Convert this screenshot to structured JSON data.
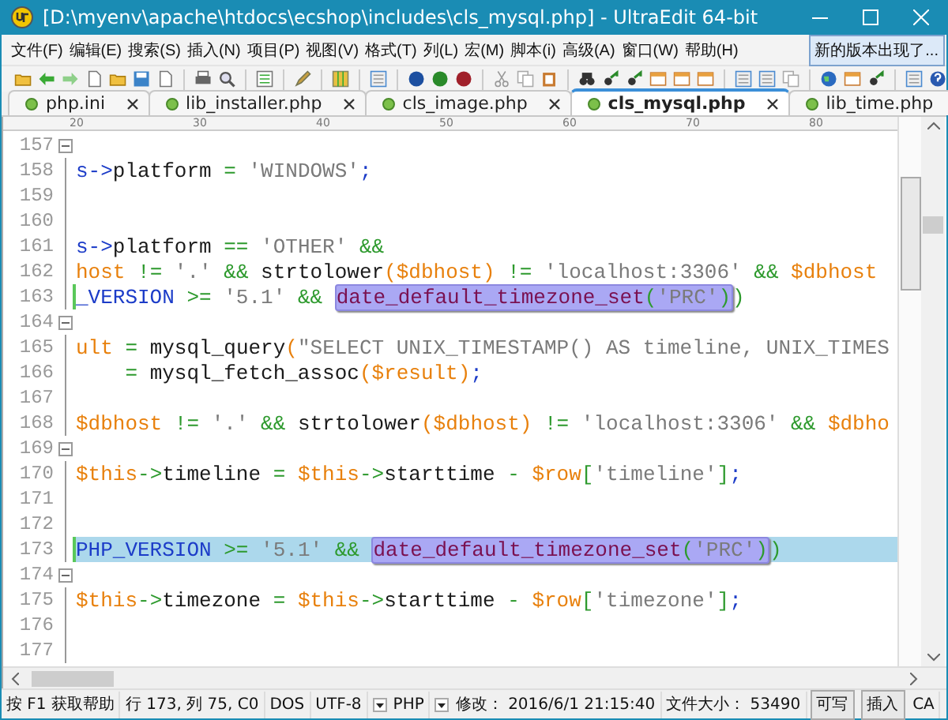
{
  "window": {
    "title": "[D:\\myenv\\apache\\htdocs\\ecshop\\includes\\cls_mysql.php] - UltraEdit 64-bit"
  },
  "menu": {
    "items": [
      "文件(F)",
      "编辑(E)",
      "搜索(S)",
      "插入(N)",
      "项目(P)",
      "视图(V)",
      "格式(T)",
      "列(L)",
      "宏(M)",
      "脚本(i)",
      "高级(A)",
      "窗口(W)",
      "帮助(H)"
    ],
    "notice_button": "新的版本出现了..."
  },
  "tabs": [
    {
      "label": "php.ini",
      "selected": false
    },
    {
      "label": "lib_installer.php",
      "selected": false
    },
    {
      "label": "cls_image.php",
      "selected": false
    },
    {
      "label": "cls_mysql.php",
      "selected": true
    },
    {
      "label": "lib_time.php",
      "selected": false
    }
  ],
  "ruler": [
    "20",
    "30",
    "40",
    "50",
    "60",
    "70",
    "80"
  ],
  "lines": [
    {
      "number": "157",
      "fold": true,
      "modified": false,
      "current": false
    },
    {
      "number": "158",
      "fold": false,
      "modified": false,
      "current": false,
      "tokens": [
        {
          "text": "s->",
          "kind": "keyword"
        },
        {
          "text": "platform ",
          "kind": "plain"
        },
        {
          "text": "=",
          "kind": "operator"
        },
        {
          "text": " 'WINDOWS'",
          "kind": "string"
        },
        {
          "text": ";",
          "kind": "keyword"
        }
      ]
    },
    {
      "number": "159",
      "fold": false,
      "modified": false,
      "current": false
    },
    {
      "number": "160",
      "fold": false,
      "modified": false,
      "current": false
    },
    {
      "number": "161",
      "fold": false,
      "modified": false,
      "current": false,
      "tokens": [
        {
          "text": "s->",
          "kind": "keyword"
        },
        {
          "text": "platform ",
          "kind": "plain"
        },
        {
          "text": "==",
          "kind": "operator"
        },
        {
          "text": " 'OTHER' ",
          "kind": "string"
        },
        {
          "text": "&&",
          "kind": "operator"
        }
      ]
    },
    {
      "number": "162",
      "fold": false,
      "modified": false,
      "current": false,
      "tokens": [
        {
          "text": "host ",
          "kind": "variable"
        },
        {
          "text": "!=",
          "kind": "operator"
        },
        {
          "text": " '.' ",
          "kind": "string"
        },
        {
          "text": "&&",
          "kind": "operator"
        },
        {
          "text": " strtolower",
          "kind": "plain"
        },
        {
          "text": "($dbhost) ",
          "kind": "variable"
        },
        {
          "text": "!=",
          "kind": "operator"
        },
        {
          "text": " 'localhost:3306' ",
          "kind": "string"
        },
        {
          "text": "&&",
          "kind": "operator"
        },
        {
          "text": " $dbhost",
          "kind": "variable"
        }
      ]
    },
    {
      "number": "163",
      "fold": false,
      "modified": true,
      "current": false,
      "tokens": [
        {
          "text": "_VERSION ",
          "kind": "keyword"
        },
        {
          "text": ">=",
          "kind": "operator"
        },
        {
          "text": " '5.1' ",
          "kind": "string"
        },
        {
          "text": "&& ",
          "kind": "operator"
        },
        {
          "kind": "match",
          "tokens": [
            {
              "text": "date_default_timezone_set",
              "kind": "function"
            },
            {
              "text": "(",
              "kind": "operator"
            },
            {
              "text": "'PRC'",
              "kind": "string"
            },
            {
              "text": ")",
              "kind": "operator"
            }
          ]
        },
        {
          "text": ")",
          "kind": "operator"
        }
      ]
    },
    {
      "number": "164",
      "fold": true,
      "modified": false,
      "current": false
    },
    {
      "number": "165",
      "fold": false,
      "modified": false,
      "current": false,
      "tokens": [
        {
          "text": "ult ",
          "kind": "variable"
        },
        {
          "text": "=",
          "kind": "operator"
        },
        {
          "text": " mysql_query",
          "kind": "plain"
        },
        {
          "text": "(",
          "kind": "variable"
        },
        {
          "text": "\"SELECT UNIX_TIMESTAMP() AS timeline, UNIX_TIMES",
          "kind": "string"
        }
      ]
    },
    {
      "number": "166",
      "fold": false,
      "modified": false,
      "current": false,
      "tokens": [
        {
          "text": "    =",
          "kind": "operator"
        },
        {
          "text": " mysql_fetch_assoc",
          "kind": "plain"
        },
        {
          "text": "($result)",
          "kind": "variable"
        },
        {
          "text": ";",
          "kind": "keyword"
        }
      ]
    },
    {
      "number": "167",
      "fold": false,
      "modified": false,
      "current": false
    },
    {
      "number": "168",
      "fold": false,
      "modified": false,
      "current": false,
      "tokens": [
        {
          "text": "$dbhost ",
          "kind": "variable"
        },
        {
          "text": "!=",
          "kind": "operator"
        },
        {
          "text": " '.' ",
          "kind": "string"
        },
        {
          "text": "&&",
          "kind": "operator"
        },
        {
          "text": " strtolower",
          "kind": "plain"
        },
        {
          "text": "($dbhost) ",
          "kind": "variable"
        },
        {
          "text": "!=",
          "kind": "operator"
        },
        {
          "text": " 'localhost:3306' ",
          "kind": "string"
        },
        {
          "text": "&&",
          "kind": "operator"
        },
        {
          "text": " $dbho",
          "kind": "variable"
        }
      ]
    },
    {
      "number": "169",
      "fold": true,
      "modified": false,
      "current": false
    },
    {
      "number": "170",
      "fold": false,
      "modified": false,
      "current": false,
      "tokens": [
        {
          "text": "$this",
          "kind": "variable"
        },
        {
          "text": "->",
          "kind": "operator"
        },
        {
          "text": "timeline ",
          "kind": "plain"
        },
        {
          "text": "=",
          "kind": "operator"
        },
        {
          "text": " $this",
          "kind": "variable"
        },
        {
          "text": "->",
          "kind": "operator"
        },
        {
          "text": "starttime ",
          "kind": "plain"
        },
        {
          "text": "-",
          "kind": "operator"
        },
        {
          "text": " $row",
          "kind": "variable"
        },
        {
          "text": "[",
          "kind": "operator"
        },
        {
          "text": "'timeline'",
          "kind": "string"
        },
        {
          "text": "]",
          "kind": "operator"
        },
        {
          "text": ";",
          "kind": "keyword"
        }
      ]
    },
    {
      "number": "171",
      "fold": false,
      "modified": false,
      "current": false
    },
    {
      "number": "172",
      "fold": false,
      "modified": false,
      "current": false
    },
    {
      "number": "173",
      "fold": false,
      "modified": true,
      "current": true,
      "tokens": [
        {
          "text": "PHP_VERSION ",
          "kind": "keyword"
        },
        {
          "text": ">=",
          "kind": "operator"
        },
        {
          "text": " '5.1' ",
          "kind": "string"
        },
        {
          "text": "&& ",
          "kind": "operator"
        },
        {
          "kind": "match",
          "tokens": [
            {
              "text": "date_default_timezone_set",
              "kind": "function"
            },
            {
              "text": "(",
              "kind": "operator"
            },
            {
              "text": "'PRC'",
              "kind": "string"
            },
            {
              "text": ")",
              "kind": "operator"
            }
          ]
        },
        {
          "text": ")",
          "kind": "operator"
        }
      ]
    },
    {
      "number": "174",
      "fold": true,
      "modified": false,
      "current": false
    },
    {
      "number": "175",
      "fold": false,
      "modified": false,
      "current": false,
      "tokens": [
        {
          "text": "$this",
          "kind": "variable"
        },
        {
          "text": "->",
          "kind": "operator"
        },
        {
          "text": "timezone ",
          "kind": "plain"
        },
        {
          "text": "=",
          "kind": "operator"
        },
        {
          "text": " $this",
          "kind": "variable"
        },
        {
          "text": "->",
          "kind": "operator"
        },
        {
          "text": "starttime ",
          "kind": "plain"
        },
        {
          "text": "-",
          "kind": "operator"
        },
        {
          "text": " $row",
          "kind": "variable"
        },
        {
          "text": "[",
          "kind": "operator"
        },
        {
          "text": "'timezone'",
          "kind": "string"
        },
        {
          "text": "]",
          "kind": "operator"
        },
        {
          "text": ";",
          "kind": "keyword"
        }
      ]
    },
    {
      "number": "176",
      "fold": false,
      "modified": false,
      "current": false
    },
    {
      "number": "177",
      "fold": false,
      "modified": false,
      "current": false
    }
  ],
  "status_bar": [
    {
      "text": "按 F1 获取帮助",
      "kind": "panel"
    },
    {
      "text": "行 173, 列 75, C0",
      "kind": "panel"
    },
    {
      "text": "DOS",
      "kind": "panel"
    },
    {
      "text": "UTF-8",
      "kind": "panel"
    },
    {
      "text": "PHP",
      "kind": "dropdown"
    },
    {
      "text": "修改： 2016/6/1 21:15:40",
      "kind": "dropdown"
    },
    {
      "text": "文件大小： 53490",
      "kind": "panel"
    },
    {
      "text": "可写",
      "kind": "button"
    },
    {
      "text": "插入",
      "kind": "button"
    },
    {
      "text": "CA",
      "kind": "panel"
    }
  ]
}
